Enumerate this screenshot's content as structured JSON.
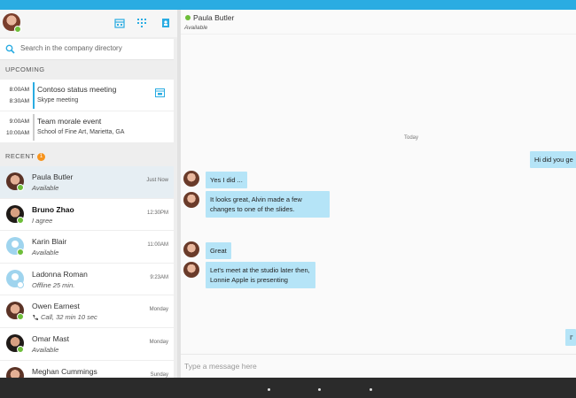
{
  "left": {
    "search_placeholder": "Search in the company directory",
    "upcoming_label": "UPCOMING",
    "meetings": [
      {
        "start": "8:00AM",
        "end": "8:30AM",
        "title": "Contoso status meeting",
        "subtitle": "Skype meeting",
        "bar_color": "#2aace2"
      },
      {
        "start": "9:00AM",
        "end": "10:00AM",
        "title": "Team morale event",
        "subtitle": "School of Fine Art, Marietta, GA",
        "bar_color": "#cccccc"
      }
    ],
    "recent_label": "RECENT",
    "recent_badge": "1",
    "contacts": [
      {
        "name": "Paula Butler",
        "status": "Available",
        "time": "Just Now"
      },
      {
        "name": "Bruno Zhao",
        "status": "I agree",
        "time": "12:30PM"
      },
      {
        "name": "Karin Blair",
        "status": "Available",
        "time": "11:00AM"
      },
      {
        "name": "Ladonna Roman",
        "status": "Offline 25 min.",
        "time": "9:23AM"
      },
      {
        "name": "Owen Earnest",
        "status": "Call, 32 min 10 sec",
        "time": "Monday"
      },
      {
        "name": "Omar Mast",
        "status": "Available",
        "time": "Monday"
      },
      {
        "name": "Meghan Cummings",
        "status": "",
        "time": "Sunday"
      }
    ]
  },
  "chat": {
    "contact_name": "Paula Butler",
    "contact_status": "Available",
    "day_label": "Today",
    "messages": [
      {
        "text": "Hi did you ge",
        "from": "me"
      },
      {
        "text": "Yes I did ...",
        "from": "them"
      },
      {
        "text": "It looks great, Alvin made a few changes to one of the slides.",
        "from": "them"
      },
      {
        "text": "Great",
        "from": "them"
      },
      {
        "text": "Let's meet at the studio later then, Lonnie Apple is presenting",
        "from": "them"
      },
      {
        "text": "I'",
        "from": "me"
      }
    ],
    "composer_placeholder": "Type a message here"
  },
  "colors": {
    "accent": "#2aace2",
    "available": "#6ebe3a",
    "bubble": "#b5e4f7",
    "badge": "#f7941d"
  }
}
